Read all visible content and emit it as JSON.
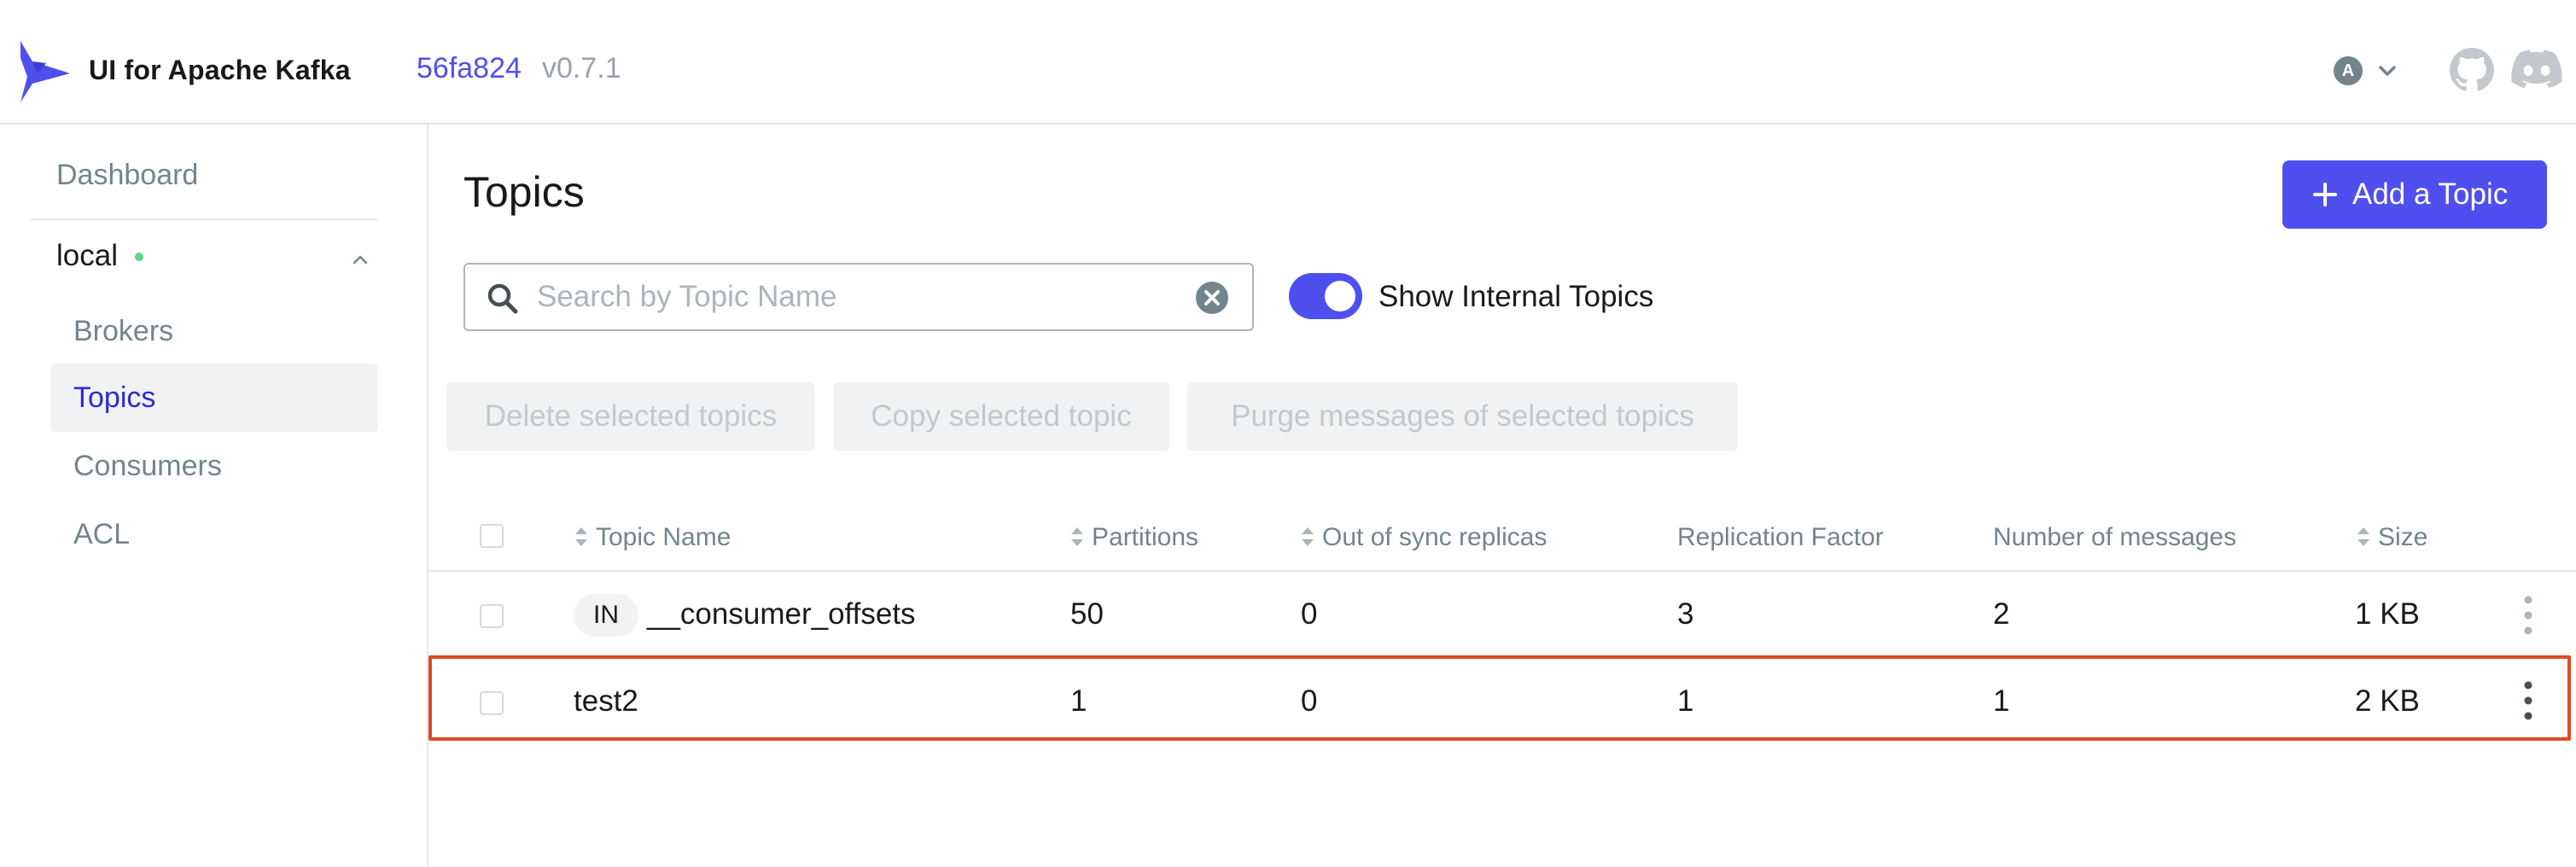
{
  "app": {
    "title": "UI for Apache Kafka",
    "version_hash": "56fa824",
    "version_tag": "v0.7.1",
    "brand_color": "#4f4ff0",
    "user_initial": "A"
  },
  "sidebar": {
    "dashboard": "Dashboard",
    "cluster": {
      "name": "local",
      "status_color": "#5cd685"
    },
    "items": [
      {
        "label": "Brokers",
        "active": false
      },
      {
        "label": "Topics",
        "active": true
      },
      {
        "label": "Consumers",
        "active": false
      },
      {
        "label": "ACL",
        "active": false
      }
    ]
  },
  "main": {
    "title": "Topics",
    "add_button": "Add a Topic",
    "search": {
      "placeholder": "Search by Topic Name",
      "value": ""
    },
    "show_internal": {
      "label": "Show Internal Topics",
      "enabled": true
    },
    "batch_actions": [
      "Delete selected topics",
      "Copy selected topic",
      "Purge messages of selected topics"
    ],
    "table": {
      "columns": [
        "Topic Name",
        "Partitions",
        "Out of sync replicas",
        "Replication Factor",
        "Number of messages",
        "Size"
      ],
      "rows": [
        {
          "internal_badge": "IN",
          "name": "__consumer_offsets",
          "partitions": "50",
          "out_of_sync": "0",
          "replication": "3",
          "messages": "2",
          "size": "1 KB",
          "highlighted": false
        },
        {
          "internal_badge": "",
          "name": "test2",
          "partitions": "1",
          "out_of_sync": "0",
          "replication": "1",
          "messages": "1",
          "size": "2 KB",
          "highlighted": true
        }
      ]
    }
  }
}
